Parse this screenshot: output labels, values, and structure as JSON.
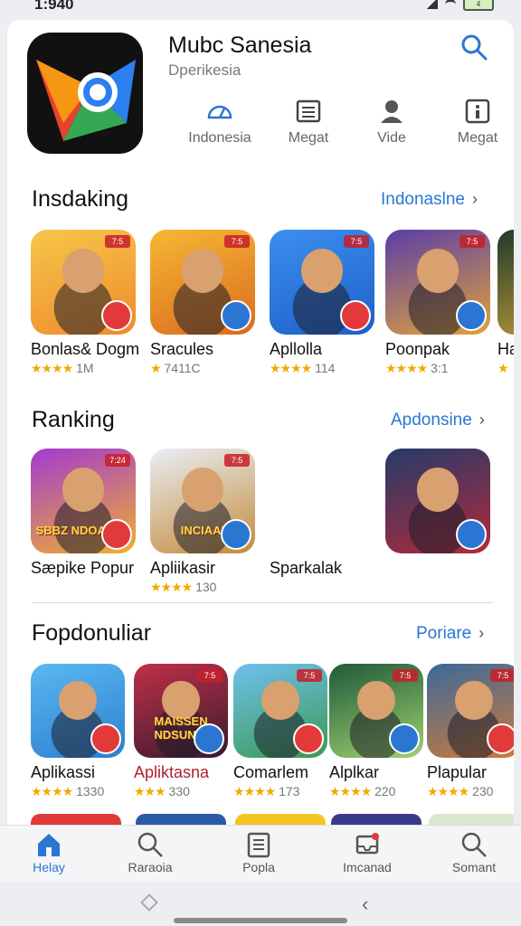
{
  "status_bar": {
    "time": "1:940",
    "battery": "4"
  },
  "header": {
    "app_name": "Mubc Sanesia",
    "subtitle": "Dperikesia"
  },
  "categories": [
    {
      "label": "Indonesia",
      "icon": "gauge-icon"
    },
    {
      "label": "Megat",
      "icon": "list-icon"
    },
    {
      "label": "Vide",
      "icon": "person-icon"
    },
    {
      "label": "Megat",
      "icon": "info-box-icon"
    }
  ],
  "sections": [
    {
      "title": "Insdaking",
      "link": "Indonaslne",
      "apps": [
        {
          "name": "Bonlas& Dogm",
          "stars": "★★★★",
          "rating": "1M",
          "badge": "7:5",
          "colors": [
            "#f6c64a",
            "#f08a2c"
          ]
        },
        {
          "name": "Sracules",
          "stars": "★",
          "rating": "7411C",
          "badge": "7:5",
          "colors": [
            "#f7b733",
            "#d96b1f"
          ]
        },
        {
          "name": "Apllolla",
          "stars": "★★★★",
          "rating": "114",
          "badge": "7:5",
          "colors": [
            "#3b8ff0",
            "#1f5fc8"
          ]
        },
        {
          "name": "Poonpak",
          "stars": "★★★★",
          "rating": "3:1",
          "badge": "7:5",
          "colors": [
            "#5a3ea8",
            "#e0a23a"
          ]
        },
        {
          "name": "Ha",
          "stars": "★",
          "rating": "",
          "badge": "",
          "colors": [
            "#1f3a2a",
            "#c9a13a"
          ]
        }
      ]
    },
    {
      "title": "Ranking",
      "link": "Apdonsine",
      "apps": [
        {
          "name": "Sæpike Popur",
          "stars": "",
          "rating": "",
          "badge": "7:24",
          "colors": [
            "#a33ad0",
            "#f0b030"
          ],
          "art": "SBBZ NDOARNS"
        },
        {
          "name": "Apliikasir",
          "stars": "★★★★",
          "rating": "130",
          "badge": "7:5",
          "colors": [
            "#e9eef5",
            "#c58b3a"
          ],
          "art": "INCIAAI"
        },
        {
          "name": "Sparkalak",
          "stars": "",
          "rating": "",
          "badge": "",
          "colors": [
            "#ffffff",
            "#ffffff"
          ]
        },
        {
          "name": "",
          "stars": "",
          "rating": "",
          "badge": "",
          "colors": [
            "#243b6a",
            "#b22a3a"
          ]
        }
      ]
    },
    {
      "title": "Fopdonuliar",
      "link": "Poriare",
      "apps": [
        {
          "name": "Aplikassi",
          "stars": "★★★★",
          "rating": "1330",
          "badge": "",
          "colors": [
            "#59b8f0",
            "#2e7fd0"
          ]
        },
        {
          "name": "Apliktasna",
          "stars": "★★★",
          "rating": "330",
          "badge": "7:5",
          "colors": [
            "#c03048",
            "#3a1a30"
          ],
          "art": "MAISSEN NDSUNAI"
        },
        {
          "name": "Comarlem",
          "stars": "★★★★",
          "rating": "173",
          "badge": "7:5",
          "colors": [
            "#6fc0f0",
            "#3a9a50"
          ]
        },
        {
          "name": "Alplkar",
          "stars": "★★★★",
          "rating": "220",
          "badge": "7:5",
          "colors": [
            "#1e5a3a",
            "#a0d070"
          ]
        },
        {
          "name": "Plapular",
          "stars": "★★★★",
          "rating": "230",
          "badge": "7:5",
          "colors": [
            "#3a6a9a",
            "#d07a3a"
          ]
        }
      ]
    }
  ],
  "bottom_nav": [
    {
      "label": "Helay",
      "icon": "home-icon",
      "active": true
    },
    {
      "label": "Raraoia",
      "icon": "search-icon",
      "active": false
    },
    {
      "label": "Popla",
      "icon": "document-icon",
      "active": false
    },
    {
      "label": "Imcanad",
      "icon": "inbox-icon",
      "active": false
    },
    {
      "label": "Somant",
      "icon": "search-icon",
      "active": false
    }
  ],
  "colors": {
    "accent": "#2a76d2",
    "star": "#f2a900"
  }
}
